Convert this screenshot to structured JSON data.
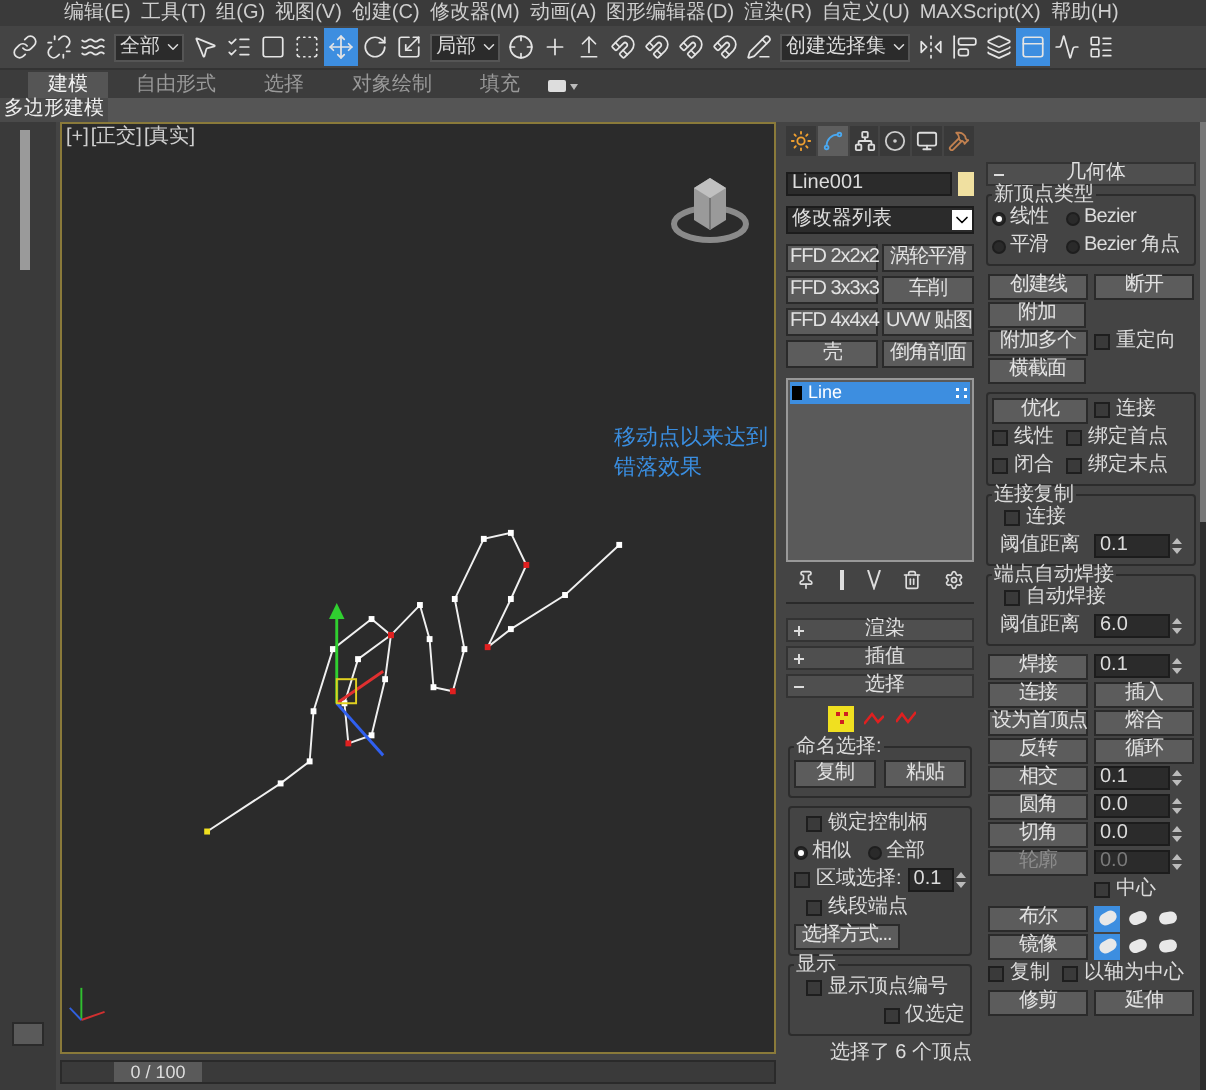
{
  "menu_bar": [
    "编辑(E)",
    "工具(T)",
    "组(G)",
    "视图(V)",
    "创建(C)",
    "修改器(M)",
    "动画(A)",
    "图形编辑器(D)",
    "渲染(R)",
    "自定义(U)",
    "MAXScript(X)",
    "帮助(H)"
  ],
  "toolbar": [
    {
      "kind": "icon",
      "selected": false
    },
    {
      "kind": "icon",
      "selected": false
    },
    {
      "kind": "icon",
      "selected": false
    },
    {
      "kind": "dropdown",
      "value": "全部"
    },
    {
      "kind": "icon",
      "selected": false
    },
    {
      "kind": "icon",
      "selected": false
    },
    {
      "kind": "icon",
      "selected": false
    },
    {
      "kind": "icon",
      "selected": false
    },
    {
      "kind": "icon",
      "selected": true
    },
    {
      "kind": "icon",
      "selected": false
    },
    {
      "kind": "icon",
      "selected": false
    },
    {
      "kind": "dropdown",
      "value": "局部"
    },
    {
      "kind": "icon",
      "selected": false
    },
    {
      "kind": "icon",
      "selected": false
    },
    {
      "kind": "icon",
      "selected": false
    },
    {
      "kind": "icon",
      "selected": false
    },
    {
      "kind": "icon",
      "selected": false
    },
    {
      "kind": "icon",
      "selected": false
    },
    {
      "kind": "icon",
      "selected": false
    },
    {
      "kind": "icon",
      "selected": false
    },
    {
      "kind": "dropdown",
      "value": "创建选择集"
    },
    {
      "kind": "icon",
      "selected": false
    },
    {
      "kind": "icon",
      "selected": false
    },
    {
      "kind": "icon",
      "selected": false
    },
    {
      "kind": "icon",
      "selected": true
    },
    {
      "kind": "icon",
      "selected": false
    },
    {
      "kind": "icon",
      "selected": false
    }
  ],
  "ribbon_tabs": [
    {
      "label": "建模",
      "selected": true
    },
    {
      "label": "自由形式",
      "selected": false
    },
    {
      "label": "选择",
      "selected": false
    },
    {
      "label": "对象绘制",
      "selected": false
    },
    {
      "label": "填充",
      "selected": false
    }
  ],
  "ribbon_panel": "多边形建模",
  "viewport": {
    "labels": [
      "[+]",
      "[正交]",
      "[真实]"
    ],
    "annotation": "移动点以来达到错落效果"
  },
  "time_slider": "0 / 100",
  "command_tabs": [
    {
      "selected": false
    },
    {
      "selected": true
    },
    {
      "selected": false
    },
    {
      "selected": false
    },
    {
      "selected": false
    },
    {
      "selected": false
    }
  ],
  "object_name": "Line001",
  "modifier_list": "修改器列表",
  "modifier_buttons": [
    "FFD 2x2x2",
    "涡轮平滑",
    "FFD 3x3x3",
    "车削",
    "FFD 4x4x4",
    "UVW 贴图",
    "壳",
    "倒角剖面"
  ],
  "modifier_stack": [
    {
      "label": "Line",
      "selected": true
    }
  ],
  "rollouts": [
    {
      "title": "渲染",
      "expanded": false
    },
    {
      "title": "插值",
      "expanded": false
    },
    {
      "title": "选择",
      "expanded": true,
      "content": {
        "levels": [
          {
            "selected": true
          },
          {
            "selected": false
          },
          {
            "selected": false
          }
        ],
        "named_selection": {
          "title": "命名选择:",
          "buttons": [
            "复制",
            "粘贴"
          ]
        },
        "options": [
          [
            {
              "kind": "checkbox",
              "label": "锁定控制柄",
              "checked": false
            }
          ],
          [
            {
              "kind": "radio",
              "label": "相似",
              "selected": true
            },
            {
              "kind": "radio",
              "label": "全部",
              "selected": false
            }
          ],
          [
            {
              "kind": "checkbox",
              "label": "区域选择:",
              "checked": false
            },
            {
              "kind": "spinner",
              "value": "0.1"
            }
          ],
          [
            {
              "kind": "checkbox",
              "label": "线段端点",
              "checked": false
            }
          ],
          [
            {
              "kind": "button",
              "label": "选择方式..."
            }
          ]
        ],
        "display": {
          "title": "显示",
          "rows": [
            [
              {
                "kind": "checkbox",
                "label": "显示顶点编号",
                "checked": false
              }
            ],
            [
              "",
              {
                "kind": "checkbox",
                "label": "仅选定",
                "checked": false
              }
            ]
          ]
        },
        "status": "选择了 6 个顶点"
      }
    }
  ],
  "geometry": {
    "title": "几何体",
    "expanded": true,
    "sections": [
      {
        "kind": "group",
        "title": "新顶点类型",
        "rows": [
          [
            {
              "kind": "radio",
              "label": "线性",
              "selected": true
            },
            {
              "kind": "radio",
              "label": "Bezier",
              "selected": false
            }
          ],
          [
            {
              "kind": "radio",
              "label": "平滑",
              "selected": false
            },
            {
              "kind": "radio",
              "label": "Bezier 角点",
              "selected": false
            }
          ]
        ]
      },
      {
        "kind": "plain",
        "rows": [
          [
            {
              "kind": "button",
              "label": "创建线"
            },
            {
              "kind": "button",
              "label": "断开"
            }
          ],
          [
            {
              "kind": "button",
              "label": "附加"
            }
          ],
          [
            {
              "kind": "button",
              "label": "附加多个"
            },
            {
              "kind": "checkbox",
              "label": "重定向",
              "checked": false
            }
          ],
          [
            {
              "kind": "button",
              "label": "横截面"
            }
          ]
        ]
      },
      {
        "kind": "group",
        "rows": [
          [
            {
              "kind": "button",
              "label": "优化"
            },
            {
              "kind": "checkbox",
              "label": "连接",
              "checked": false
            }
          ],
          [
            {
              "kind": "checkbox",
              "label": "线性",
              "checked": false
            },
            {
              "kind": "checkbox",
              "label": "绑定首点",
              "checked": false
            }
          ],
          [
            {
              "kind": "checkbox",
              "label": "闭合",
              "checked": false
            },
            {
              "kind": "checkbox",
              "label": "绑定末点",
              "checked": false
            }
          ]
        ]
      },
      {
        "kind": "group",
        "title": "连接复制",
        "rows": [
          [
            {
              "kind": "checkbox",
              "label": "连接",
              "checked": false
            }
          ],
          [
            {
              "kind": "label",
              "text": "阈值距离"
            },
            {
              "kind": "spinner",
              "value": "0.1",
              "disabled": false
            }
          ]
        ]
      },
      {
        "kind": "group",
        "title": "端点自动焊接",
        "rows": [
          [
            {
              "kind": "checkbox",
              "label": "自动焊接",
              "checked": false
            }
          ],
          [
            {
              "kind": "label",
              "text": "阈值距离"
            },
            {
              "kind": "spinner",
              "value": "6.0",
              "disabled": false
            }
          ]
        ]
      },
      {
        "kind": "plain",
        "rows": [
          [
            {
              "kind": "button",
              "label": "焊接",
              "disabled": false
            },
            {
              "kind": "spinner",
              "value": "0.1",
              "disabled": false
            }
          ],
          [
            {
              "kind": "button",
              "label": "连接"
            },
            {
              "kind": "button",
              "label": "插入"
            }
          ],
          [
            {
              "kind": "button",
              "label": "设为首顶点"
            },
            {
              "kind": "button",
              "label": "熔合"
            }
          ],
          [
            {
              "kind": "button",
              "label": "反转"
            },
            {
              "kind": "button",
              "label": "循环"
            }
          ],
          [
            {
              "kind": "button",
              "label": "相交",
              "disabled": false
            },
            {
              "kind": "spinner",
              "value": "0.1",
              "disabled": false
            }
          ],
          [
            {
              "kind": "button",
              "label": "圆角",
              "disabled": false
            },
            {
              "kind": "spinner",
              "value": "0.0",
              "disabled": false
            }
          ],
          [
            {
              "kind": "button",
              "label": "切角",
              "disabled": false
            },
            {
              "kind": "spinner",
              "value": "0.0",
              "disabled": false
            }
          ],
          [
            {
              "kind": "button",
              "label": "轮廓",
              "disabled": true
            },
            {
              "kind": "spinner",
              "value": "0.0",
              "disabled": true
            }
          ],
          [
            "",
            {
              "kind": "checkbox",
              "label": "中心",
              "checked": false
            }
          ],
          [
            {
              "kind": "button",
              "label": "布尔"
            },
            {
              "kind": "toggles",
              "items": [
                {
                  "selected": true
                },
                {
                  "selected": false
                },
                {
                  "selected": false
                }
              ]
            }
          ],
          [
            {
              "kind": "button",
              "label": "镜像"
            },
            {
              "kind": "toggles",
              "items": [
                {
                  "selected": true
                },
                {
                  "selected": false
                },
                {
                  "selected": false
                }
              ]
            }
          ],
          [
            {
              "kind": "checkbox",
              "label": "复制",
              "checked": false
            },
            {
              "kind": "checkbox",
              "label": "以轴为中心",
              "checked": false
            }
          ],
          [
            {
              "kind": "button",
              "label": "修剪"
            },
            {
              "kind": "button",
              "label": "延伸"
            }
          ]
        ]
      }
    ]
  }
}
